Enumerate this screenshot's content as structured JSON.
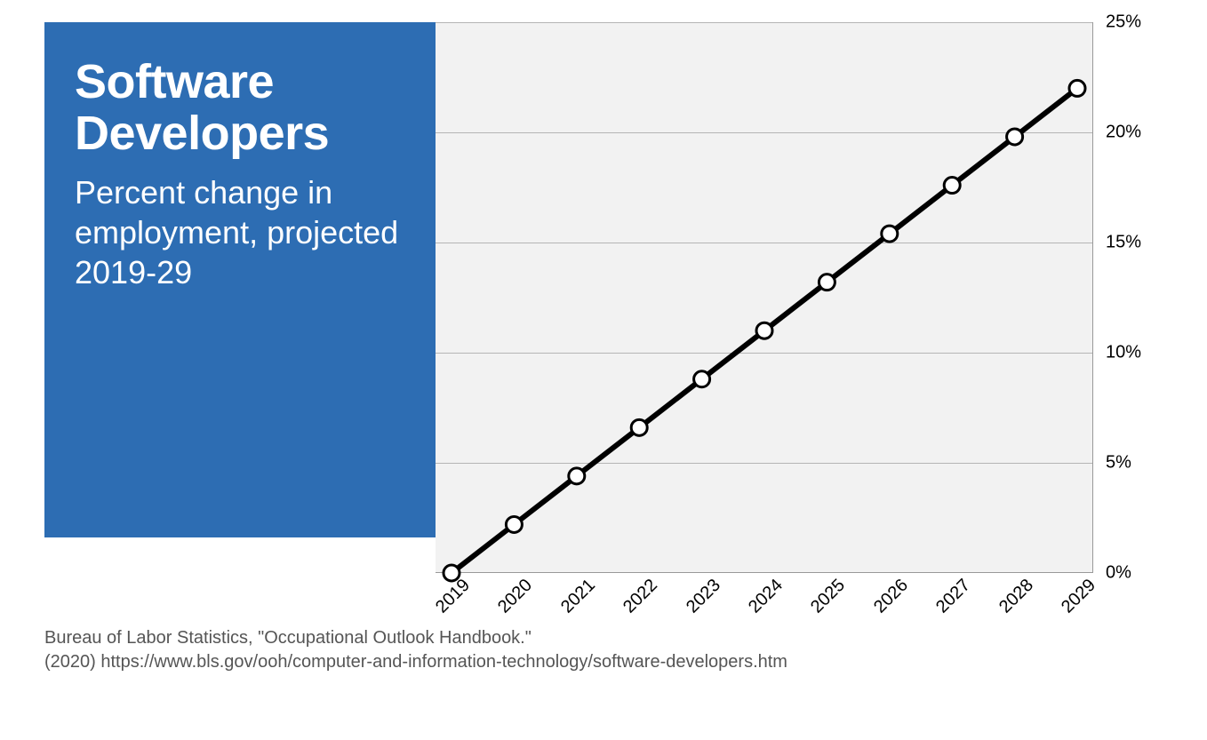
{
  "panel": {
    "title_line1": "Software",
    "title_line2": "Developers",
    "subtitle": "Percent change in employment, projected 2019-29"
  },
  "source": {
    "line1": "Bureau of Labor Statistics, \"Occupational Outlook Handbook.\"",
    "line2": "(2020) https://www.bls.gov/ooh/computer-and-information-technology/software-developers.htm"
  },
  "chart_data": {
    "type": "line",
    "categories": [
      "2019",
      "2020",
      "2021",
      "2022",
      "2023",
      "2024",
      "2025",
      "2026",
      "2027",
      "2028",
      "2029"
    ],
    "values": [
      0,
      2.2,
      4.4,
      6.6,
      8.8,
      11.0,
      13.2,
      15.4,
      17.6,
      19.8,
      22.0
    ],
    "y_ticks": [
      "0%",
      "5%",
      "10%",
      "15%",
      "20%",
      "25%"
    ],
    "y_tick_values": [
      0,
      5,
      10,
      15,
      20,
      25
    ],
    "ylim": [
      0,
      25
    ],
    "title": "",
    "xlabel": "",
    "ylabel": ""
  },
  "colors": {
    "accent": "#2d6db3",
    "plot_bg": "#f2f2f2",
    "line": "#000000",
    "marker_fill": "#ffffff"
  }
}
